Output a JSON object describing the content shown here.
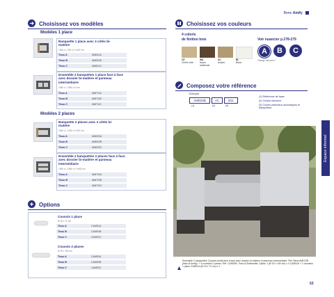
{
  "brand": {
    "prefix": "Bene",
    "name": "Amify"
  },
  "colors": {
    "navy": "#2b2f7e",
    "box_border": "#b8c2dc",
    "row_bg": "#e9ecf3"
  },
  "models_section": {
    "icon": "arrow-right-icon",
    "title": "Choisissez vos modèles",
    "one_seat_title": "Modèles 1 place",
    "two_seat_title": "Modèles 2 places",
    "products": [
      {
        "title": "Banquette 1 place avec 3 côtés bi-matière",
        "dims": "l 960 x L 932 x H 1187 cm",
        "rows": [
          [
            "Tissu A",
            "AMB11A"
          ],
          [
            "Tissu B",
            "AMB11B"
          ],
          [
            "Tissu C",
            "AMB11C"
          ]
        ]
      },
      {
        "title": "Ensemble 2 banquettes 1 place face à face avec dossier bi-matière et panneau intermédiaire",
        "dims": "l 960 x L 1990 x H cm",
        "rows": [
          [
            "Tissu A",
            "AMF11A"
          ],
          [
            "Tissu B",
            "AMF11B"
          ],
          [
            "Tissu C",
            "AMF11C"
          ]
        ]
      },
      {
        "title": "Banquette 2 places avec 3 côtés bi-matière",
        "dims": "l 960 x L 1932 x H 937 cm",
        "rows": [
          [
            "Tissu A",
            "AMB22A"
          ],
          [
            "Tissu B",
            "AMB22B"
          ],
          [
            "Tissu C",
            "AMB22C"
          ]
        ]
      },
      {
        "title": "Ensemble 2 banquettes 2 places face à face avec dossier bi-matière et panneau intermédiaire",
        "dims": "l 960 x L 1990 x H 1990 cm",
        "rows": [
          [
            "Tissu A",
            "AMF22A"
          ],
          [
            "Tissu B",
            "AMF22B"
          ],
          [
            "Tissu C",
            "AMF22C"
          ]
        ]
      }
    ]
  },
  "options_section": {
    "icon": "plus-icon",
    "title": "Options",
    "items": [
      {
        "title": "Coussin 1 place",
        "dims": "Ø 15 x 72 cm",
        "rows": [
          [
            "Tissu A",
            "CAM01A"
          ],
          [
            "Tissu B",
            "CAM01B"
          ],
          [
            "Tissu C",
            "CAM01C"
          ]
        ]
      },
      {
        "title": "Coussin 2 places",
        "dims": "Ø 15 x 150 cm",
        "rows": [
          [
            "Tissu A",
            "CAM02A"
          ],
          [
            "Tissu B",
            "CAM02B"
          ],
          [
            "Tissu C",
            "CAM02C"
          ]
        ]
      }
    ]
  },
  "colors_section": {
    "icon": "palette-icon",
    "title": "Choisissez vos couleurs",
    "wood_label_1": "4 coloris",
    "wood_label_2": "de finition bois",
    "nuancier": "Voir nuancier p.278-279",
    "fabric_letters": [
      "A",
      "B",
      "C"
    ],
    "swatches": [
      {
        "code": "CE",
        "name": "Chêne clair",
        "color": "#c9b48c"
      },
      {
        "code": "WA",
        "name": "Noyer américain",
        "color": "#5c4530"
      },
      {
        "code": "AC",
        "name": "Acacia",
        "color": "#b39a72"
      },
      {
        "code": "BL",
        "name": "Blanc",
        "color": "#f2f1ec"
      }
    ],
    "extra": "Orange velours n°"
  },
  "reference_section": {
    "icon": "pencil-icon",
    "title": "Composez votre référence",
    "example_label": "Exemple",
    "boxes": [
      "AMD22B",
      "AC",
      "B11"
    ],
    "box_labels": [
      "(1)",
      "(2)",
      "(3)"
    ],
    "legend": [
      "(1) Référence de base",
      "(2) Coloris structure",
      "(3) Coloris panneaux acoustiques et banquettes"
    ]
  },
  "side_tab": "Espace informel",
  "photo_caption": "Ensemble 2 banquettes 2 places Amify face à face avec dossier bi-matière et panneau intermédiaire. Réf. Bene AMF22B (tissu B Amify). + 4 coussins 2 places. Réf. CAM02B. Tissu A Shetlandia. Option 1 (Ø 15 x 150 cm) x 4 CAM02A + 2 coussins 1 place CAM01A (Ø 15 x 72 cm) x 2.",
  "page_number": "53"
}
